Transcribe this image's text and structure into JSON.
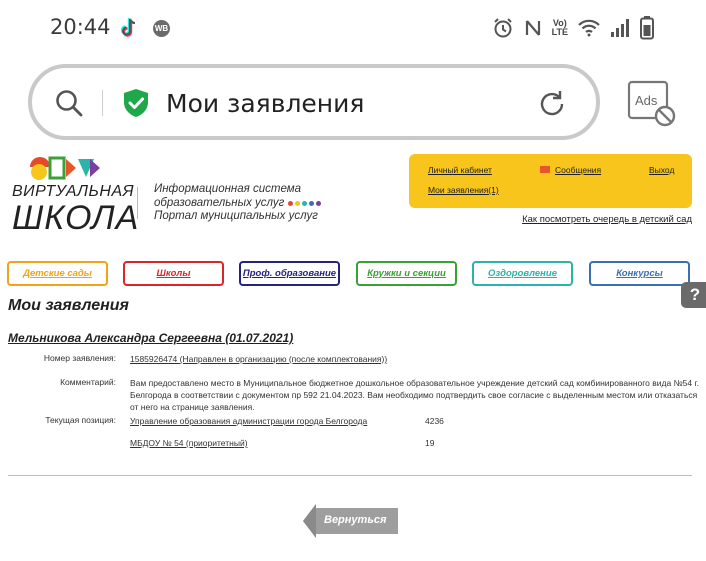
{
  "status_bar": {
    "time": "20:44",
    "left_icons": [
      "tiktok-icon",
      "wb-icon"
    ],
    "wb_badge": "WB",
    "right_icons": [
      "alarm-icon",
      "nfc-icon",
      "volte-icon",
      "wifi-icon",
      "signal-icon",
      "battery-icon"
    ],
    "lte_text": "Vo) LTE"
  },
  "browser": {
    "page_title": "Мои заявления",
    "ads_label": "Ads",
    "icons": [
      "search-icon",
      "shield-check-icon",
      "reload-icon",
      "ads-block-icon"
    ],
    "colors": {
      "shield": "#1fa84a",
      "border": "#c9c9c9"
    }
  },
  "header": {
    "logo_line1": "ВИРТУАЛЬНАЯ",
    "logo_line2": "ШКОЛА",
    "sysinfo_line1": "Информационная система",
    "sysinfo_line2": "образовательных услуг",
    "sysinfo_line3": "Портал муниципальных услуг",
    "userbox": {
      "cabinet": "Личный кабинет",
      "messages": "Сообщения",
      "logout": "Выход",
      "my_applications": "Мои заявления(1)"
    },
    "queue_link": "Как посмотреть очередь в детский сад",
    "colors": {
      "userbox_bg": "#f7c51b"
    }
  },
  "categories": [
    {
      "label": "Детские сады",
      "color": "#f0a31a"
    },
    {
      "label": "Школы",
      "color": "#d8262b"
    },
    {
      "label": "Проф. образование",
      "color": "#23257d"
    },
    {
      "label": "Кружки и секции",
      "color": "#3aa136"
    },
    {
      "label": "Оздоровление",
      "color": "#2bb3ac"
    },
    {
      "label": "Конкурсы",
      "color": "#3a6fb5"
    }
  ],
  "main": {
    "heading": "Мои заявления",
    "applicant": "Мельникова Александра Сергеевна (01.07.2021)",
    "rows": {
      "number_label": "Номер заявления:",
      "number_value": "1585926474 (Направлен в организацию (после комплектования))",
      "comment_label": "Комментарий:",
      "comment_value": "Вам предоставлено место в Муниципальное бюджетное дошкольное образовательное учреждение детский сад комбинированного вида №54 г. Белгорода в соответствии с документом пр 592 21.04.2023. Вам необходимо подтвердить свое согласие с выделенным местом или отказаться от него на странице заявления.",
      "position_label": "Текущая позиция:",
      "position1_name": "Управление образования администрации города Белгорода",
      "position1_value": "4236",
      "position2_name": "МБДОУ № 54 (приоритетный)",
      "position2_value": "19"
    },
    "back_button": "Вернуться",
    "help_label": "?"
  }
}
